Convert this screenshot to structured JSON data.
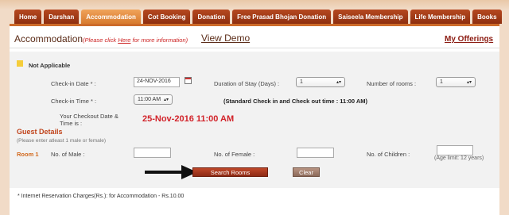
{
  "nav": {
    "items": [
      {
        "label": "Home",
        "active": false
      },
      {
        "label": "Darshan",
        "active": false
      },
      {
        "label": "Accommodation",
        "active": true
      },
      {
        "label": "Cot Booking",
        "active": false
      },
      {
        "label": "Donation",
        "active": false
      },
      {
        "label": "Free Prasad Bhojan Donation",
        "active": false
      },
      {
        "label": "Saiseela Membership",
        "active": false
      },
      {
        "label": "Life Membership",
        "active": false
      },
      {
        "label": "Books",
        "active": false
      }
    ]
  },
  "header": {
    "title": "Accommodation",
    "note_prefix": "(Please click ",
    "note_link": "Here",
    "note_suffix": " for more information)",
    "view_demo": "View Demo",
    "my_offerings": "My Offerings"
  },
  "legend": {
    "label": "Not Applicable",
    "color": "#f5cd3a"
  },
  "form": {
    "checkin_date_label": "Check-in Date * :",
    "checkin_date_value": "24-NOV-2016",
    "duration_label": "Duration of Stay (Days) :",
    "duration_value": "1",
    "rooms_label": "Number of rooms :",
    "rooms_value": "1",
    "checkin_time_label": "Check-in Time * :",
    "checkin_time_value": "11:00 AM",
    "standard_note": "(Standard Check in and Check out time : 11:00 AM)",
    "checkout_label": "Your Checkout Date & Time is :",
    "checkout_value": "25-Nov-2016 11:00 AM"
  },
  "guests": {
    "title": "Guest Details",
    "note": "(Please enter atleast 1 male or female)",
    "room_label": "Room 1",
    "male_label": "No. of Male :",
    "female_label": "No. of Female :",
    "children_label": "No. of Children :",
    "age_limit": "(Age limit: 12 years)"
  },
  "actions": {
    "search_label": "Search Rooms",
    "clear_label": "Clear"
  },
  "footer": {
    "note": "* Internet Reservation Charges(Rs.):  for Accommodation - Rs.10.00"
  },
  "colors": {
    "accent": "#cd6b2a",
    "nav_bg": "#a33c17",
    "nav_active": "#e58c42",
    "checkout_red": "#d2232a"
  }
}
